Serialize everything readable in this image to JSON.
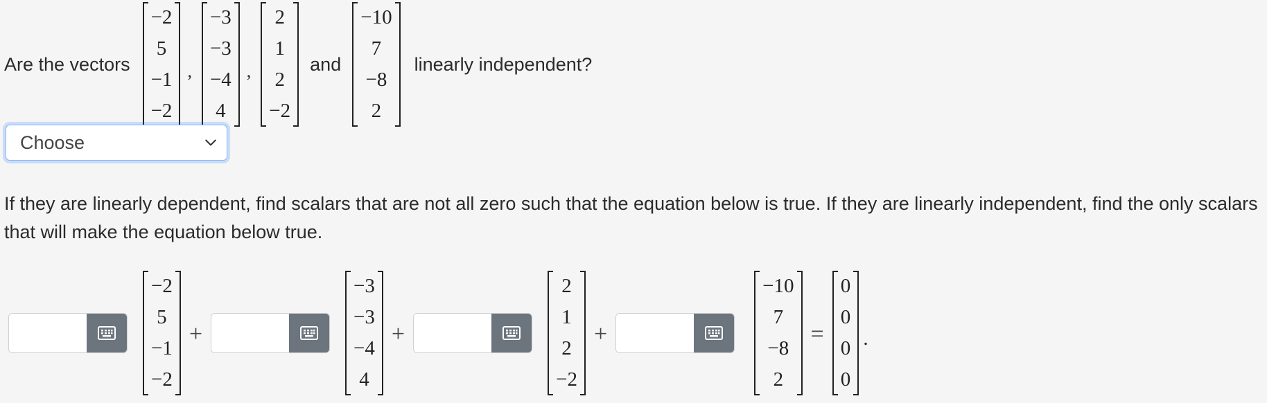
{
  "question": {
    "prefix": "Are the vectors",
    "sep_and": "and",
    "suffix": "linearly independent?"
  },
  "vectors": [
    [
      "−2",
      "5",
      "−1",
      "−2"
    ],
    [
      "−3",
      "−3",
      "−4",
      "4"
    ],
    [
      "2",
      "1",
      "2",
      "−2"
    ],
    [
      "−10",
      "7",
      "−8",
      "2"
    ]
  ],
  "zero_vector": [
    "0",
    "0",
    "0",
    "0"
  ],
  "commas": [
    ",",
    ","
  ],
  "dropdown": {
    "selected": "Choose"
  },
  "instructions": "If they are linearly dependent, find scalars that are not all zero such that the equation below is true. If they are linearly independent, find the only scalars that will make the equation below true.",
  "equation": {
    "plus": "+",
    "equals": "=",
    "period": "."
  },
  "answer_inputs": [
    {
      "value": ""
    },
    {
      "value": ""
    },
    {
      "value": ""
    },
    {
      "value": ""
    }
  ],
  "icons": {
    "keyboard": "keyboard-icon",
    "dropdown": "chevron-down-icon"
  },
  "colors": {
    "keyboard_button": "#6c757d",
    "focus_border": "#86b7fe",
    "background": "#f5f5f5"
  }
}
